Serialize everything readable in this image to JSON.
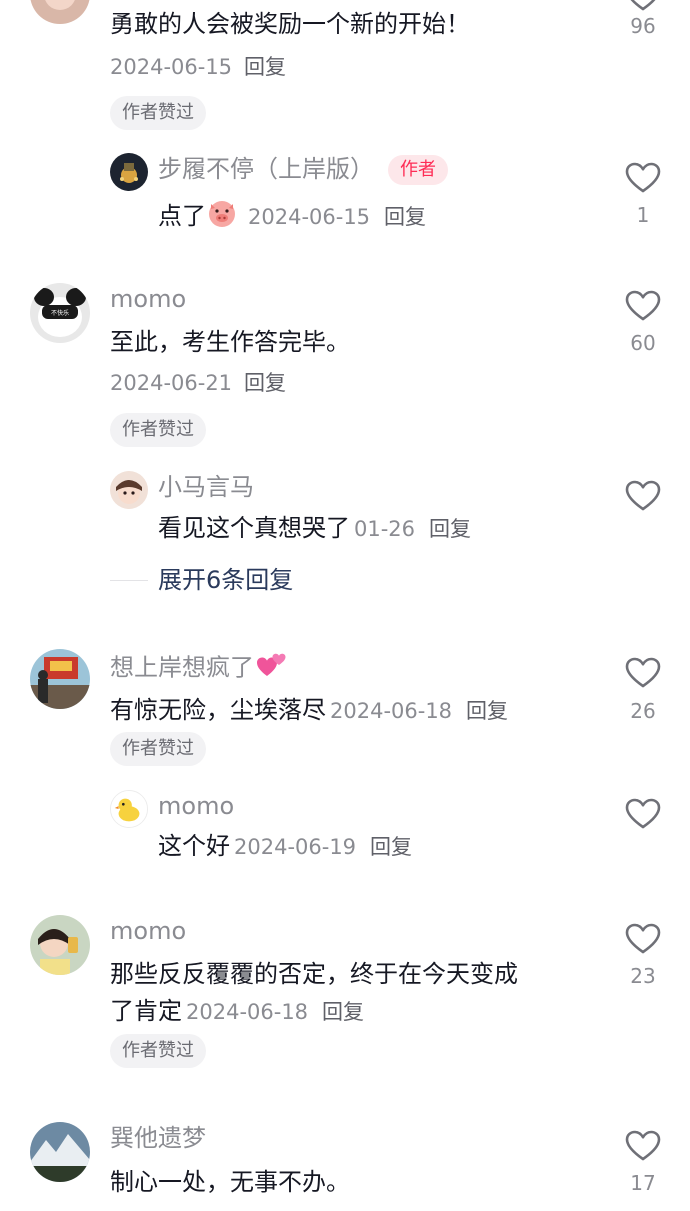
{
  "comments": [
    {
      "text": "勇敢的人会被奖励一个新的开始！",
      "date": "2024-06-15",
      "reply_label": "回复",
      "likes": "96",
      "badge": "作者赞过",
      "replies": [
        {
          "name": "步履不停（上岸版）",
          "tag": "作者",
          "text": "点了",
          "date": "2024-06-15",
          "reply_label": "回复",
          "likes": "1"
        }
      ]
    },
    {
      "name": "momo",
      "text": "至此，考生作答完毕。",
      "date": "2024-06-21",
      "reply_label": "回复",
      "likes": "60",
      "badge": "作者赞过",
      "replies": [
        {
          "name": "小马言马",
          "text": "看见这个真想哭了",
          "date": "01-26",
          "reply_label": "回复"
        }
      ],
      "expand_label": "展开6条回复"
    },
    {
      "name": "想上岸想疯了",
      "text": "有惊无险，尘埃落尽",
      "date": "2024-06-18",
      "reply_label": "回复",
      "likes": "26",
      "badge": "作者赞过",
      "replies": [
        {
          "name": "momo",
          "text": "这个好",
          "date": "2024-06-19",
          "reply_label": "回复"
        }
      ]
    },
    {
      "name": "momo",
      "text_line1": "那些反反覆覆的否定，终于在今天变成",
      "text_line2": "了肯定",
      "date": "2024-06-18",
      "reply_label": "回复",
      "likes": "23",
      "badge": "作者赞过"
    },
    {
      "name": "巽他遗梦",
      "text": "制心一处，无事不办。",
      "likes": "17"
    }
  ],
  "colors": {
    "accent": "#fe2c55",
    "name_gray": "#8a8b91",
    "text_dark": "#161823",
    "expand_blue": "#2a3a5c"
  },
  "icons": {
    "like": "heart-outline-icon",
    "emoji_pig": "pig-face-emoji-icon",
    "emoji_hearts": "two-hearts-emoji-icon"
  }
}
